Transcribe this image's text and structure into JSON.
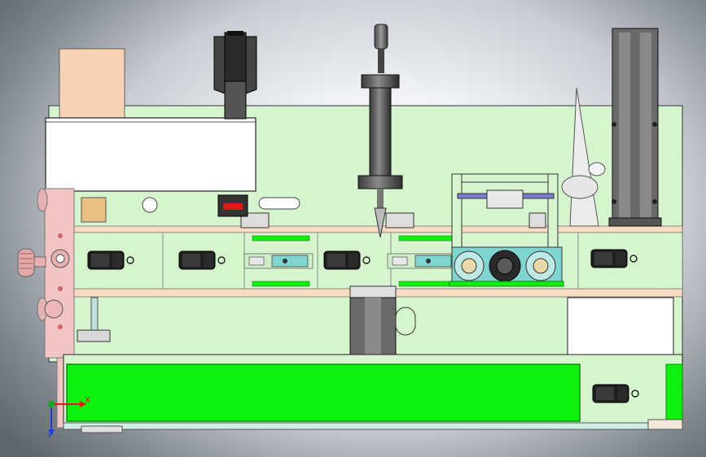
{
  "axes": {
    "x_label": "X",
    "y_label": "Y",
    "x_color": "#e01818",
    "y_color": "#1e3fd0",
    "origin_color": "#1aa81a"
  },
  "colors": {
    "frame_green": "#d6f5cf",
    "belt_green": "#0ef00e",
    "dark_green": "#0a8a0a",
    "pink": "#f2c4c4",
    "motor": "#1e1e1e",
    "cyan_block": "#7fd6d0",
    "gray_cylinder": "#5c5c5c"
  }
}
